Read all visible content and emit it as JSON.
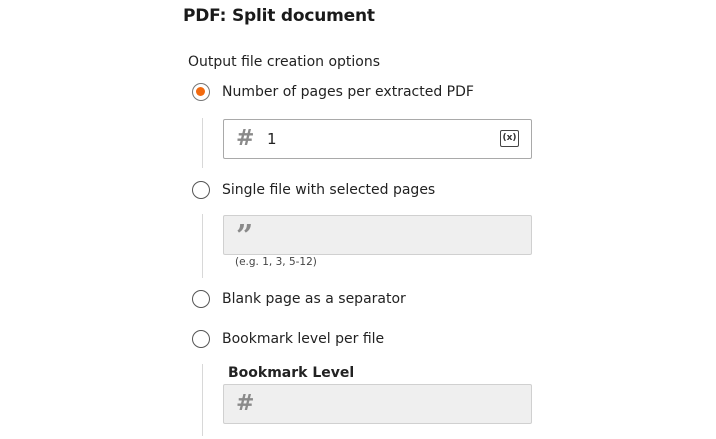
{
  "title": "PDF: Split document",
  "section_label": "Output file creation options",
  "options": [
    {
      "label": "Number of pages per extracted PDF",
      "selected": true
    },
    {
      "label": "Single file with selected pages",
      "selected": false
    },
    {
      "label": "Blank page as a separator",
      "selected": false
    },
    {
      "label": "Bookmark level per file",
      "selected": false
    }
  ],
  "pages_per_pdf": {
    "icon": "hash-icon",
    "value": "1",
    "variable_button": "(x)"
  },
  "selected_pages": {
    "icon": "quote-icon",
    "value": "",
    "hint": "(e.g. 1, 3, 5-12)"
  },
  "bookmark_level": {
    "label": "Bookmark Level",
    "icon": "hash-icon",
    "value": ""
  },
  "colors": {
    "accent": "#f26a0f",
    "disabled_field": "#efefef",
    "border": "#a9a9a9"
  }
}
